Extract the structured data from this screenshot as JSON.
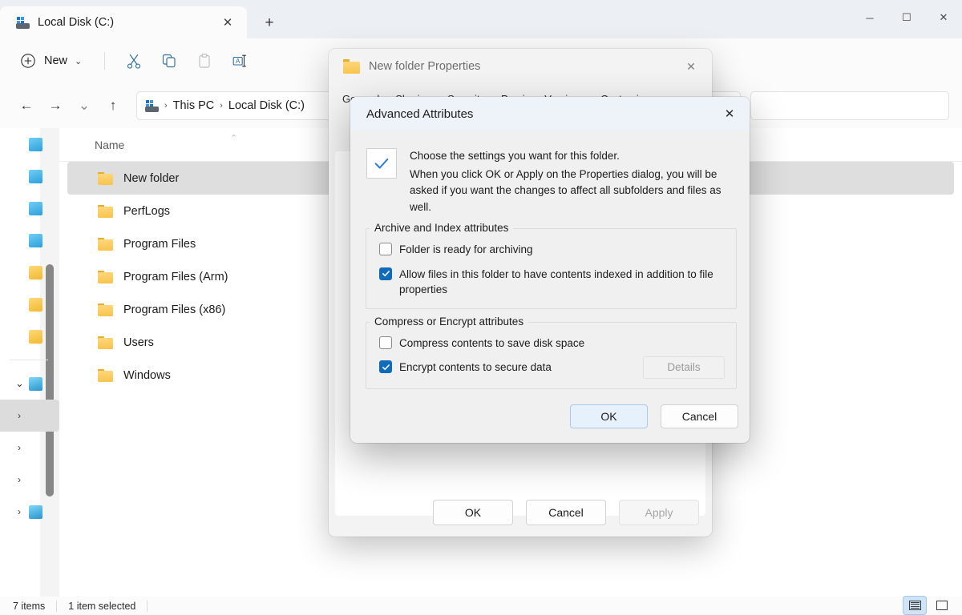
{
  "window": {
    "tab": {
      "title": "Local Disk (C:)",
      "icon": "drive-icon",
      "close": "✕"
    },
    "new_tab": "+",
    "controls": {
      "minimize": "─",
      "maximize": "☐",
      "close": "✕"
    }
  },
  "toolbar": {
    "new_label": "New",
    "new_chevron": "⌄",
    "items": [
      {
        "name": "cut",
        "label": "Cut"
      },
      {
        "name": "copy",
        "label": "Copy"
      },
      {
        "name": "paste",
        "label": "Paste"
      },
      {
        "name": "rename",
        "label": "Rename"
      }
    ]
  },
  "nav": {
    "back": "←",
    "forward": "→",
    "recent": "⌄",
    "up": "↑",
    "breadcrumb": [
      "This PC",
      "Local Disk (C:)"
    ],
    "separator": "›",
    "search_placeholder": ""
  },
  "navpane": {
    "scroll_visible": true,
    "items": [
      {
        "icon": "cloud",
        "expand": ""
      },
      {
        "icon": "cloud",
        "expand": ""
      },
      {
        "icon": "cloud",
        "expand": ""
      },
      {
        "icon": "cloud",
        "expand": ""
      },
      {
        "icon": "folder",
        "expand": ""
      },
      {
        "icon": "folder",
        "expand": ""
      },
      {
        "icon": "folder",
        "expand": ""
      },
      {
        "icon": "pc",
        "expand": "⌄",
        "divider_before": true
      },
      {
        "icon": "",
        "expand": "›",
        "selected": true
      },
      {
        "icon": "",
        "expand": "›"
      },
      {
        "icon": "",
        "expand": "›"
      },
      {
        "icon": "network",
        "expand": "›"
      }
    ]
  },
  "filelist": {
    "column_name": "Name",
    "sort_indicator": "⌃",
    "rows": [
      {
        "name": "New folder",
        "selected": true
      },
      {
        "name": "PerfLogs",
        "selected": false
      },
      {
        "name": "Program Files",
        "selected": false
      },
      {
        "name": "Program Files (Arm)",
        "selected": false
      },
      {
        "name": "Program Files (x86)",
        "selected": false
      },
      {
        "name": "Users",
        "selected": false
      },
      {
        "name": "Windows",
        "selected": false
      }
    ]
  },
  "statusbar": {
    "item_count": "7 items",
    "selection": "1 item selected",
    "views": [
      {
        "name": "details-view",
        "active": true
      },
      {
        "name": "large-icons-view",
        "active": false
      }
    ]
  },
  "properties_dialog": {
    "title": "New folder Properties",
    "close": "✕",
    "tabs": [
      "General",
      "Sharing",
      "Security",
      "Previous Versions",
      "Customize"
    ],
    "active_tab": "General",
    "buttons": [
      {
        "label": "OK",
        "disabled": false
      },
      {
        "label": "Cancel",
        "disabled": false
      },
      {
        "label": "Apply",
        "disabled": true
      }
    ]
  },
  "advanced_dialog": {
    "title": "Advanced Attributes",
    "close": "✕",
    "intro_line1": "Choose the settings you want for this folder.",
    "intro_line2": "When you click OK or Apply on the Properties dialog, you will be asked if you want the changes to affect all subfolders and files as well.",
    "groups": [
      {
        "label": "Archive and Index attributes",
        "checkboxes": [
          {
            "label": "Folder is ready for archiving",
            "checked": false
          },
          {
            "label": "Allow files in this folder to have contents indexed in addition to file properties",
            "checked": true
          }
        ]
      },
      {
        "label": "Compress or Encrypt attributes",
        "checkboxes": [
          {
            "label": "Compress contents to save disk space",
            "checked": false
          },
          {
            "label": "Encrypt contents to secure data",
            "checked": true
          }
        ],
        "details_button": {
          "label": "Details",
          "disabled": true
        }
      }
    ],
    "buttons": [
      {
        "label": "OK",
        "default": true
      },
      {
        "label": "Cancel",
        "default": false
      }
    ]
  },
  "colors": {
    "accent": "#0f6cbd",
    "folder": "#f7c34a",
    "selection": "#dedede",
    "dialog_bg": "#f0f0f0"
  }
}
